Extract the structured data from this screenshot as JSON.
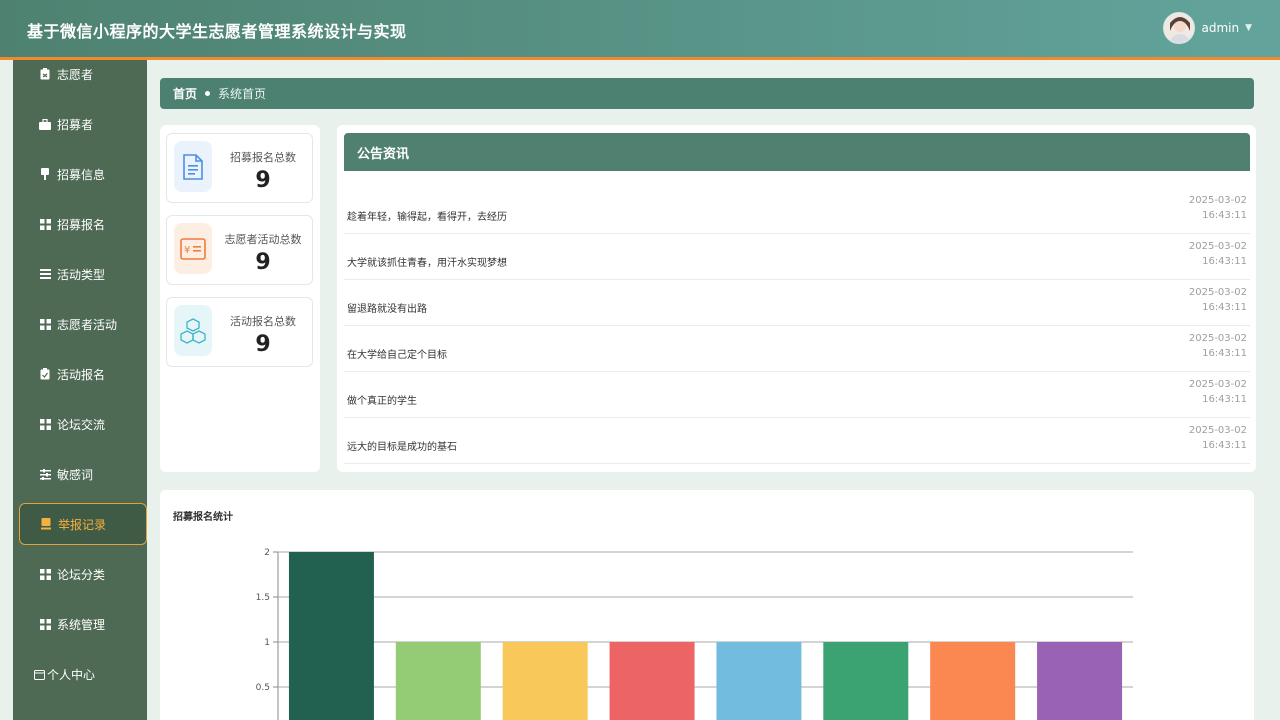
{
  "header": {
    "app_title": "基于微信小程序的大学生志愿者管理系统设计与实现",
    "user_name": "admin"
  },
  "sidebar": {
    "items": [
      {
        "label": "志愿者",
        "icon": "clipboard-icon"
      },
      {
        "label": "招募者",
        "icon": "briefcase-icon"
      },
      {
        "label": "招募信息",
        "icon": "pin-icon"
      },
      {
        "label": "招募报名",
        "icon": "grid-icon"
      },
      {
        "label": "活动类型",
        "icon": "list-icon"
      },
      {
        "label": "志愿者活动",
        "icon": "grid-icon"
      },
      {
        "label": "活动报名",
        "icon": "clipboard-icon"
      },
      {
        "label": "论坛交流",
        "icon": "grid-icon"
      },
      {
        "label": "敏感词",
        "icon": "sliders-icon"
      },
      {
        "label": "举报记录",
        "icon": "report-icon"
      },
      {
        "label": "论坛分类",
        "icon": "grid-icon"
      },
      {
        "label": "系统管理",
        "icon": "grid-icon"
      },
      {
        "label": "个人中心",
        "icon": "calendar-icon"
      }
    ],
    "active": "举报记录"
  },
  "breadcrumb": {
    "home": "首页",
    "current": "系统首页"
  },
  "stats": [
    {
      "label": "招募报名总数",
      "value": "9",
      "icon": "document-icon",
      "color": "#4a90e2"
    },
    {
      "label": "志愿者活动总数",
      "value": "9",
      "icon": "money-icon",
      "color": "#f07c3c"
    },
    {
      "label": "活动报名总数",
      "value": "9",
      "icon": "cubes-icon",
      "color": "#3bb6c8"
    }
  ],
  "notices": {
    "title": "公告资讯",
    "items": [
      {
        "title": "趁着年轻，输得起，看得开，去经历",
        "date": "2025-03-02",
        "time": "16:43:11"
      },
      {
        "title": "大学就该抓住青春，用汗水实现梦想",
        "date": "2025-03-02",
        "time": "16:43:11"
      },
      {
        "title": "留退路就没有出路",
        "date": "2025-03-02",
        "time": "16:43:11"
      },
      {
        "title": "在大学给自己定个目标",
        "date": "2025-03-02",
        "time": "16:43:11"
      },
      {
        "title": "做个真正的学生",
        "date": "2025-03-02",
        "time": "16:43:11"
      },
      {
        "title": "远大的目标是成功的基石",
        "date": "2025-03-02",
        "time": "16:43:11"
      }
    ]
  },
  "chart_data": {
    "type": "bar",
    "title": "招募报名统计",
    "xlabel": "",
    "ylabel": "",
    "ylim": [
      0,
      2
    ],
    "yticks": [
      "2",
      "1.5",
      "1",
      "0.5"
    ],
    "values": [
      2,
      1,
      1,
      1,
      1,
      1,
      1,
      1
    ],
    "colors": [
      "#22614f",
      "#93cc74",
      "#f9c85a",
      "#ec6464",
      "#72bcdf",
      "#3ba271",
      "#fb8751",
      "#9a62b4"
    ],
    "grid": true
  },
  "colors": {
    "header": "#4e8170",
    "sidebar": "#4e6a54",
    "accent": "#f08a2c",
    "active": "#f4b13f"
  }
}
